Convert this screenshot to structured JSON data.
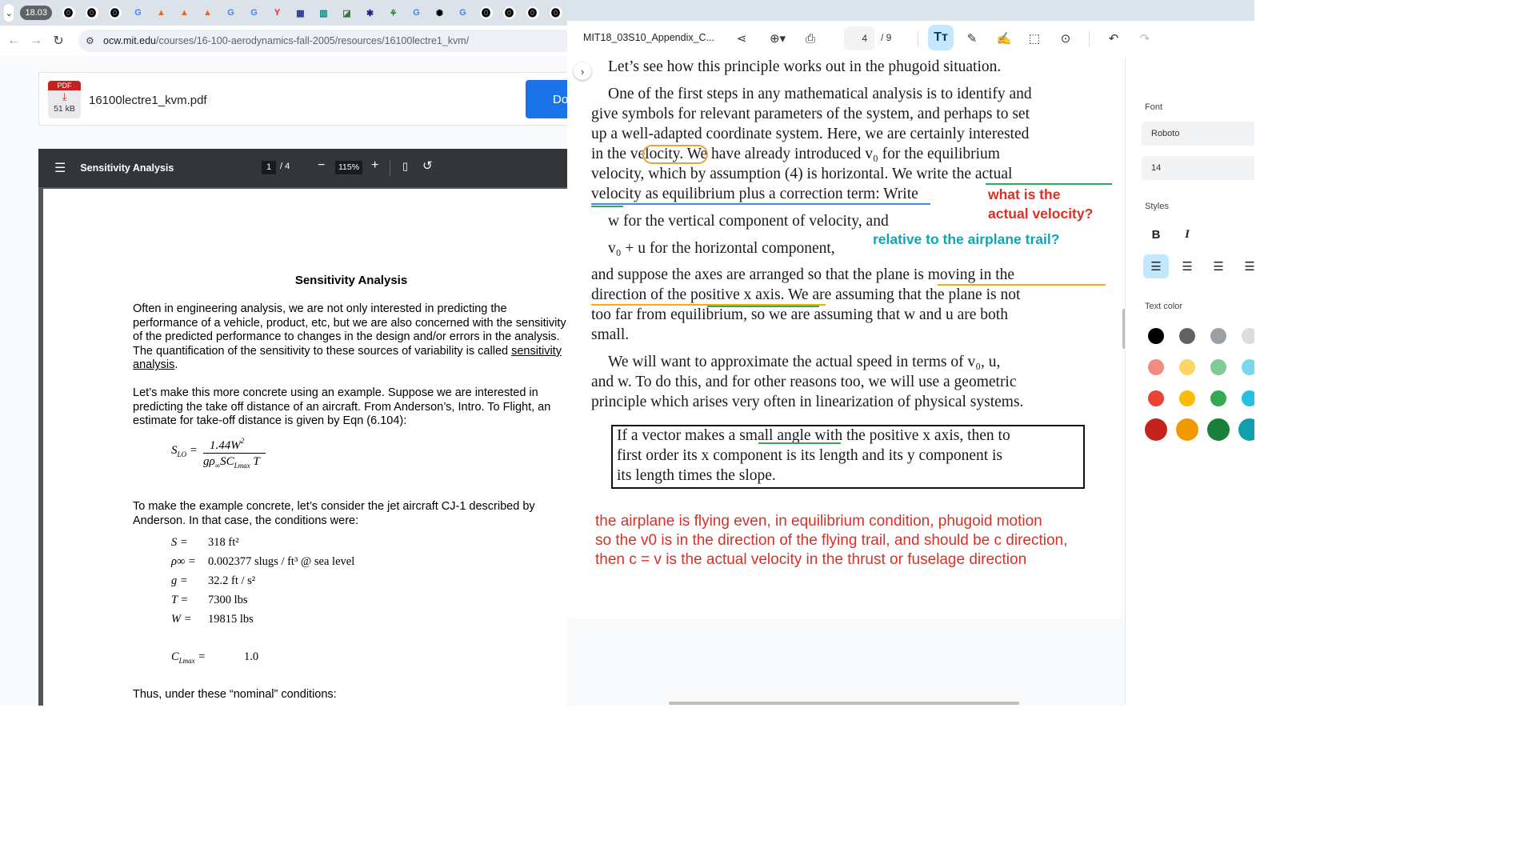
{
  "left_browser": {
    "tab_group_label": "18.03",
    "tab_icons": [
      {
        "name": "ocw-icon",
        "glyph": "⓿",
        "color": "#000000",
        "bg": "#ffffff"
      },
      {
        "name": "ocw-icon",
        "glyph": "⓿",
        "color": "#000000",
        "bg": "#ffffff"
      },
      {
        "name": "ocw-icon",
        "glyph": "⓿",
        "color": "#000000",
        "bg": "#ffffff"
      },
      {
        "name": "google-icon",
        "glyph": "G",
        "color": "#4285f4",
        "bg": "transparent"
      },
      {
        "name": "matlab-icon",
        "glyph": "▲",
        "color": "#e16a1f",
        "bg": "transparent"
      },
      {
        "name": "matlab-icon",
        "glyph": "▲",
        "color": "#e16a1f",
        "bg": "transparent"
      },
      {
        "name": "matlab-icon",
        "glyph": "▲",
        "color": "#e16a1f",
        "bg": "transparent"
      },
      {
        "name": "google-icon",
        "glyph": "G",
        "color": "#4285f4",
        "bg": "transparent"
      },
      {
        "name": "google-icon",
        "glyph": "G",
        "color": "#4285f4",
        "bg": "transparent"
      },
      {
        "name": "y-combinator-icon",
        "glyph": "Y",
        "color": "#d93025",
        "bg": "transparent"
      },
      {
        "name": "app-icon",
        "glyph": "▦",
        "color": "#283593",
        "bg": "transparent"
      },
      {
        "name": "chart-app-icon",
        "glyph": "▥",
        "color": "#00897b",
        "bg": "transparent"
      },
      {
        "name": "draw-app-icon",
        "glyph": "◪",
        "color": "#2e7d32",
        "bg": "transparent"
      },
      {
        "name": "star-app-icon",
        "glyph": "✱",
        "color": "#1a237e",
        "bg": "transparent"
      },
      {
        "name": "android-app-icon",
        "glyph": "⚘",
        "color": "#2e7d32",
        "bg": "transparent"
      },
      {
        "name": "google-icon",
        "glyph": "G",
        "color": "#4285f4",
        "bg": "transparent"
      },
      {
        "name": "openai-icon",
        "glyph": "✺",
        "color": "#000000",
        "bg": "transparent"
      },
      {
        "name": "google-icon",
        "glyph": "G",
        "color": "#4285f4",
        "bg": "transparent"
      },
      {
        "name": "ocw-icon",
        "glyph": "⓿",
        "color": "#000000",
        "bg": "#ffffff"
      },
      {
        "name": "ocw-icon",
        "glyph": "⓿",
        "color": "#000000",
        "bg": "#ffffff"
      },
      {
        "name": "ocw-icon",
        "glyph": "⓿",
        "color": "#000000",
        "bg": "#ffffff"
      },
      {
        "name": "ocw-icon",
        "glyph": "⓿",
        "color": "#000000",
        "bg": "#ffffff"
      }
    ],
    "url_host": "ocw.mit.edu",
    "url_path": "/courses/16-100-aerodynamics-fall-2005/resources/16100lectre1_kvm/",
    "pdf_card": {
      "badge": "PDF",
      "size": "51 kB",
      "file_name": "16100lectre1_kvm.pdf",
      "download_label": "Do"
    },
    "viewer": {
      "title": "Sensitivity Analysis",
      "page": "1",
      "page_total": "/ 4",
      "zoom": "115%"
    },
    "paper": {
      "title": "Sensitivity Analysis",
      "p1_pre": "Often in engineering analysis, we are not only interested in predicting the performance of a vehicle, product, etc, but we are also concerned with the sensitivity of the predicted performance to changes in the design and/or errors in the analysis.  The quantification of the sensitivity to these sources of variability is called ",
      "p1_link": "sensitivity analysis",
      "p1_post": ".",
      "p2": "Let’s make this more concrete using an example.  Suppose we are interested in predicting the take off distance of an aircraft.  From Anderson’s, Intro. To Flight, an estimate for take-off distance is given by Eqn (6.104):",
      "p3": "To make the example concrete, let’s consider the jet aircraft CJ-1 described by Anderson.  In that case, the conditions were:",
      "p4": "Thus, under these “nominal” conditions:",
      "params": [
        {
          "label": "S =",
          "value": "318 ft²"
        },
        {
          "label": "ρ∞ =",
          "value": "0.002377 slugs / ft³ @ sea level"
        },
        {
          "label": "g =",
          "value": "32.2 ft / s²"
        },
        {
          "label": "T =",
          "value": "7300 lbs"
        },
        {
          "label": "W =",
          "value": "19815 lbs"
        }
      ],
      "clmax_value": "1.0"
    }
  },
  "right_pane": {
    "doc_title": "MIT18_03S10_Appendix_C...",
    "page": "4",
    "page_total": "/  9",
    "lines": [
      "Let’s see how this principle works out in the phugoid situation.",
      "One of the first steps in any mathematical analysis is to identify and",
      "give symbols for relevant parameters of the system, and perhaps to set",
      "up a well-adapted coordinate system. Here, we are certainly interested",
      "in the velocity. We have already introduced v₀ for the equilibrium",
      "velocity, which by assumption (4) is horizontal. We write the actual",
      "velocity as equilibrium plus a correction term: Write",
      "w for the vertical component of velocity, and",
      "v₀ + u for the horizontal component,",
      "and suppose the axes are arranged so that the plane is moving in the",
      "direction of the positive x axis. We are assuming that the plane is not",
      "too far from equilibrium, so we are assuming that w and u are both",
      "small.",
      "We will want to approximate the actual speed in terms of v₀, u,",
      "and w. To do this, and for other reasons too, we will use a geometric",
      "principle which arises very often in linearization of physical systems."
    ],
    "box_lines": [
      "If a vector makes a small angle with the positive x axis, then to",
      "first order its x component is its length and its y component is",
      "its length times the slope."
    ],
    "annotations": {
      "red_1": "what is the",
      "red_2": "actual velocity?",
      "teal": "relative to the airplane trail?",
      "note_1": "the airplane is flying even, in equilibrium condition, phugoid motion",
      "note_2": "so the v0 is in the direction of the flying trail, and should be c direction,",
      "note_3": "then c = v is the actual velocity in the thrust or fuselage direction"
    },
    "side_panel": {
      "font_label": "Font",
      "font_value": "Roboto",
      "size_value": "14",
      "styles_label": "Styles",
      "bold": "B",
      "italic": "I",
      "text_color_label": "Text color",
      "colors": [
        "#000000",
        "#5f6368",
        "#9aa0a6",
        "#dadce0",
        "#f28b82",
        "#fdd663",
        "#81c995",
        "#78d9ec",
        "#ea4335",
        "#fbbc04",
        "#34a853",
        "#24c1e0",
        "#c5221f",
        "#f29900",
        "#188038",
        "#129eaf"
      ]
    }
  }
}
